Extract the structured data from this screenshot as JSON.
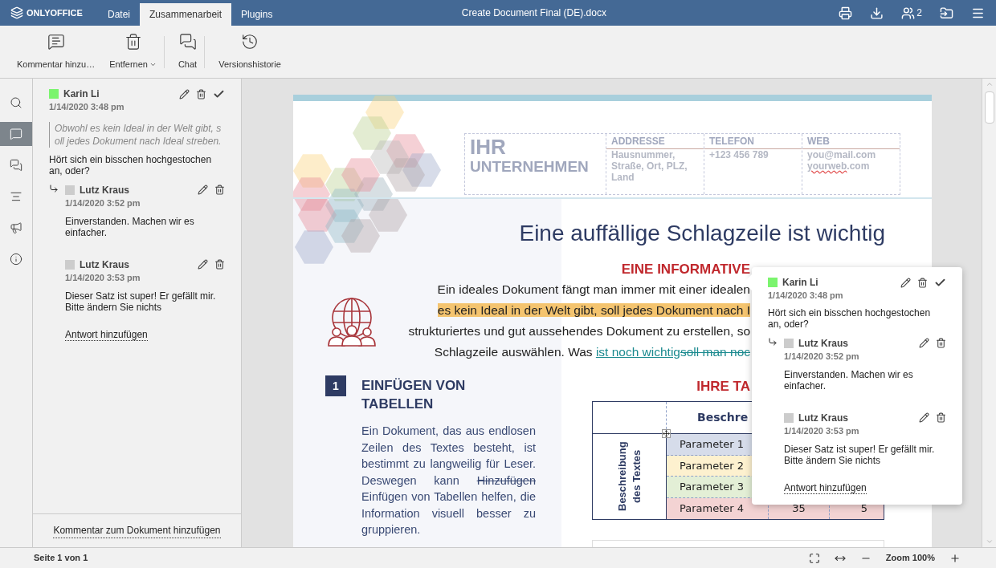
{
  "header": {
    "logo": "ONLYOFFICE",
    "tabs": [
      {
        "label": "Datei",
        "selected": false
      },
      {
        "label": "Zusammenarbeit",
        "selected": true
      },
      {
        "label": "Plugins",
        "selected": false
      }
    ],
    "title": "Create Document Final (DE).docx",
    "users_count": "2"
  },
  "toolbar": {
    "buttons": [
      {
        "kind": "comment",
        "label": "Kommentar hinzu…",
        "dropdown": false,
        "separator_after": false
      },
      {
        "kind": "delete",
        "label": "Entfernen",
        "dropdown": true,
        "separator_after": true
      },
      {
        "kind": "chat",
        "label": "Chat",
        "dropdown": false,
        "separator_after": true
      },
      {
        "kind": "history",
        "label": "Versionshistorie",
        "dropdown": false,
        "separator_after": false
      }
    ]
  },
  "left_rail": [
    {
      "kind": "search",
      "selected": false
    },
    {
      "kind": "comments",
      "selected": true
    },
    {
      "kind": "chat",
      "selected": false
    },
    {
      "kind": "navigation",
      "selected": false
    },
    {
      "kind": "feedback",
      "selected": false
    },
    {
      "kind": "about",
      "selected": false
    }
  ],
  "comments_panel": {
    "thread": {
      "author": "Karin Li",
      "color": "#7bf46e",
      "time": "1/14/2020 3:48 pm",
      "quote": "Obwohl es kein Ideal in der Welt gibt, soll jedes Dokument nach Ideal streben.",
      "text": "Hört sich ein bisschen hochgestochen an, oder?",
      "replies": [
        {
          "author": "Lutz Kraus",
          "color": "#cccccc",
          "time": "1/14/2020 3:52 pm",
          "text": "Einverstanden. Machen wir es einfacher."
        },
        {
          "author": "Lutz Kraus",
          "color": "#cccccc",
          "time": "1/14/2020 3:53 pm",
          "text": "Dieser Satz ist super! Er gefällt mir. Bitte ändern Sie nichts"
        }
      ],
      "reply_link": "Antwort hinzufügen"
    },
    "add_comment": "Kommentar zum Dokument hinzufügen"
  },
  "document": {
    "company": [
      "IHR",
      "UNTERNEHMEN"
    ],
    "contact_columns": [
      {
        "heading": "ADDRESSE",
        "lines": [
          [
            {
              "text": "Hausnummer,",
              "spelling_error": false
            }
          ],
          [
            {
              "text": "Straße, Ort, PLZ,",
              "spelling_error": false
            }
          ],
          [
            {
              "text": "Land",
              "spelling_error": false
            }
          ]
        ]
      },
      {
        "heading": "TELEFON",
        "lines": [
          [
            {
              "text": "+123 456 789",
              "spelling_error": false
            }
          ]
        ]
      },
      {
        "heading": "WEB",
        "lines": [
          [
            {
              "text": "you@mail.com",
              "spelling_error": false
            }
          ],
          [
            {
              "text": "yourweb",
              "spelling_error": true
            },
            {
              "text": ".com",
              "spelling_error": false
            }
          ]
        ]
      }
    ],
    "headline": "Eine auffällige Schlagzeile ist wichtig",
    "subheading": "EINE INFORMATIVE",
    "intro_lines": [
      [
        {
          "kind": "plain",
          "text": "Ein ideales Dokument fängt man immer mit einer idealen"
        }
      ],
      [
        {
          "kind": "highlight",
          "text": "es kein Ideal in der Welt gibt, soll jedes Dokument nach I"
        }
      ],
      [
        {
          "kind": "plain",
          "text": "strukturiertes und gut aussehendes Dokument zu erstellen, so"
        }
      ],
      [
        {
          "kind": "plain",
          "text": "Schlagzeile auswählen. Was "
        },
        {
          "kind": "inserted",
          "text": "ist noch wichtig"
        },
        {
          "kind": "deleted",
          "text": "soll man noc"
        }
      ]
    ],
    "section": {
      "number": "1",
      "title": "EINFÜGEN VON TABELLEN",
      "paragraph": [
        {
          "kind": "plain",
          "text": "Ein Dokument, das aus endlosen Zeilen des Textes besteht, ist bestimmt zu langweilig für Leser. Deswegen kann "
        },
        {
          "kind": "deleted",
          "text": "Hinzufügen"
        },
        {
          "kind": "plain",
          "text": " Einfügen von Tabellen helfen, die Information visuell besser zu gruppieren."
        }
      ]
    },
    "table_title": "IHRE TA",
    "table": {
      "row_header": "Beschreibung des Textes",
      "column_header": "Beschre",
      "rows": [
        {
          "label": "Parameter 1",
          "color": "#d6dcea",
          "values": []
        },
        {
          "label": "Parameter 2",
          "color": "#fdf1cf",
          "values": []
        },
        {
          "label": "Parameter 3",
          "color": "#e3efd6",
          "values": []
        },
        {
          "label": "Parameter 4",
          "color": "#f3d3d3",
          "values": [
            "35",
            "5"
          ]
        }
      ]
    }
  },
  "comment_popover": {
    "author": "Karin Li",
    "color": "#7bf46e",
    "time": "1/14/2020 3:48 pm",
    "text": "Hört sich ein bisschen hochgestochen an, oder?",
    "replies": [
      {
        "author": "Lutz Kraus",
        "color": "#cccccc",
        "time": "1/14/2020 3:52 pm",
        "text": "Einverstanden. Machen wir es einfacher."
      },
      {
        "author": "Lutz Kraus",
        "color": "#cccccc",
        "time": "1/14/2020 3:53 pm",
        "text": "Dieser Satz ist super! Er gefällt mir. Bitte ändern Sie nichts"
      }
    ],
    "reply_link": "Antwort hinzufügen"
  },
  "status_bar": {
    "page": "Seite 1 von 1",
    "zoom": "Zoom 100%"
  }
}
